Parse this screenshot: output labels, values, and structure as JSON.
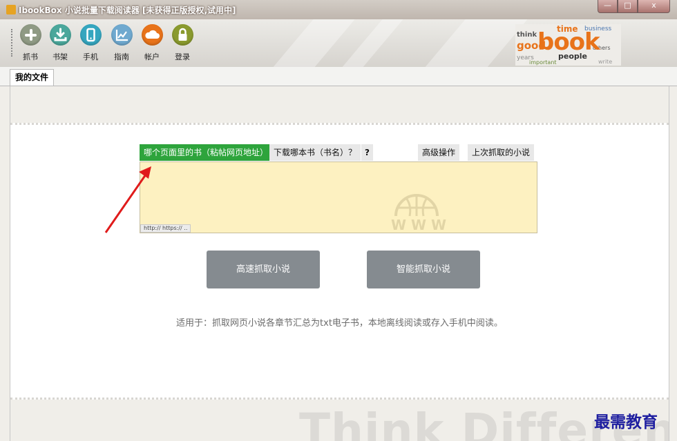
{
  "window": {
    "title": "IbookBox 小说批量下载阅读器 [未获得正版授权,试用中]",
    "controls": {
      "minimize": "—",
      "maximize": "□",
      "close": "x"
    }
  },
  "toolbar": {
    "items": [
      {
        "label": "抓书",
        "icon": "plus-icon",
        "color": "#8f9a84"
      },
      {
        "label": "书架",
        "icon": "download-icon",
        "color": "#4aa79b"
      },
      {
        "label": "手机",
        "icon": "phone-icon",
        "color": "#35a6bf"
      },
      {
        "label": "指南",
        "icon": "chart-icon",
        "color": "#6fa9cf"
      },
      {
        "label": "帐户",
        "icon": "cloud-icon",
        "color": "#e8731a"
      },
      {
        "label": "登录",
        "icon": "lock-icon",
        "color": "#8a9a2e"
      }
    ],
    "logo": {
      "big_word": "book",
      "words": [
        "think",
        "time",
        "good",
        "people",
        "business",
        "years",
        "important",
        "others",
        "write"
      ]
    }
  },
  "tabs": [
    {
      "label": "我的文件"
    }
  ],
  "main": {
    "input_tabs": {
      "page_url": "哪个页面里的书（粘帖网页地址）",
      "book_name": "下载哪本书（书名）？",
      "help": "?",
      "advanced": "高级操作",
      "last_fetched": "上次抓取的小说"
    },
    "url_input": {
      "value": "",
      "hint": "http:// https:// .."
    },
    "globe_text": "W W W",
    "buttons": {
      "fast": "高速抓取小说",
      "smart": "智能抓取小说"
    },
    "applies_text": "适用于：抓取网页小说各章节汇总为txt电子书，本地离线阅读或存入手机中阅读。",
    "background_text": "Think Different"
  },
  "watermark": "最需教育",
  "colors": {
    "accent_green": "#2ea43c",
    "button_grey": "#858b90",
    "input_bg": "#fdf1c1",
    "arrow": "#e01b1b"
  }
}
